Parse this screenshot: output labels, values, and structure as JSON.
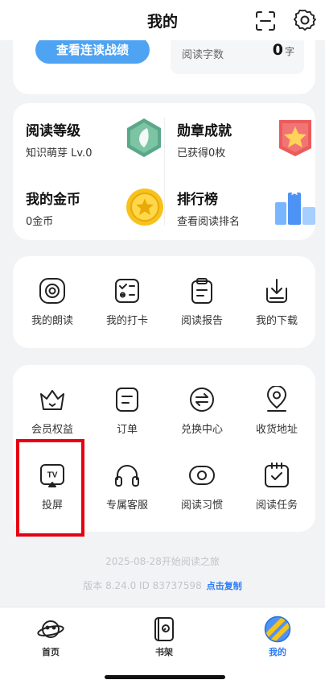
{
  "header": {
    "title": "我的"
  },
  "reading": {
    "streak_button": "查看连读战绩",
    "words_label": "阅读字数",
    "words_value": "0",
    "words_unit": "字"
  },
  "stats": [
    {
      "title": "阅读等级",
      "subtitle": "知识萌芽 Lv.0",
      "icon": "leaf-hexagon-icon"
    },
    {
      "title": "勋章成就",
      "subtitle": "已获得0枚",
      "icon": "star-medal-icon"
    },
    {
      "title": "我的金币",
      "subtitle": "0金币",
      "icon": "gold-coin-icon"
    },
    {
      "title": "排行榜",
      "subtitle": "查看阅读排名",
      "icon": "podium-icon"
    }
  ],
  "grid1": [
    {
      "label": "我的朗读",
      "icon": "broadcast-icon"
    },
    {
      "label": "我的打卡",
      "icon": "checklist-icon"
    },
    {
      "label": "阅读报告",
      "icon": "clipboard-icon"
    },
    {
      "label": "我的下载",
      "icon": "download-icon"
    }
  ],
  "grid2": [
    {
      "label": "会员权益",
      "icon": "crown-icon"
    },
    {
      "label": "订单",
      "icon": "order-icon"
    },
    {
      "label": "兑换中心",
      "icon": "exchange-icon"
    },
    {
      "label": "收货地址",
      "icon": "location-icon"
    },
    {
      "label": "投屏",
      "icon": "tv-cast-icon"
    },
    {
      "label": "专属客服",
      "icon": "headset-icon"
    },
    {
      "label": "阅读习惯",
      "icon": "eye-habit-icon"
    },
    {
      "label": "阅读任务",
      "icon": "task-calendar-icon"
    }
  ],
  "footer": {
    "start_text": "2025-08-28开始阅读之旅",
    "version_text": "版本 8.24.0  ID 83737598",
    "copy_label": "点击复制"
  },
  "tabs": [
    {
      "label": "首页",
      "icon": "planet-icon",
      "active": false
    },
    {
      "label": "书架",
      "icon": "bookshelf-icon",
      "active": false
    },
    {
      "label": "我的",
      "icon": "profile-stripe-icon",
      "active": true
    }
  ],
  "colors": {
    "accent": "#2e7cf6",
    "highlight": "#e60012",
    "streak_button": "#4ea3f2"
  }
}
